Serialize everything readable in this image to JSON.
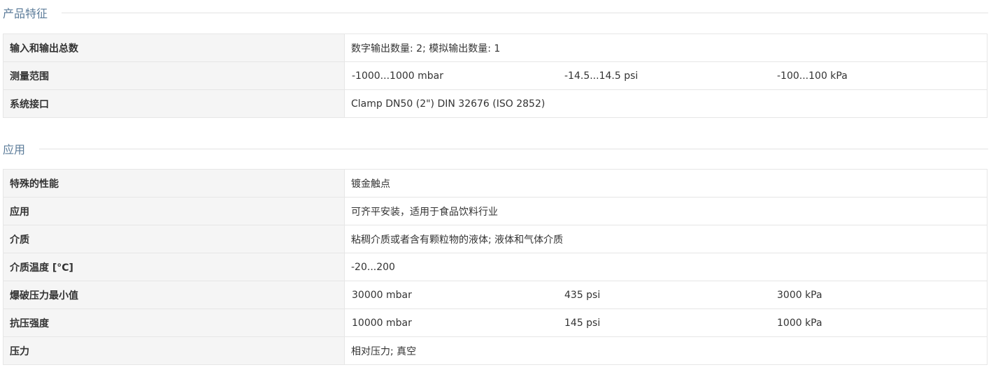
{
  "sections": [
    {
      "title": "产品特征",
      "rows": [
        {
          "label": "输入和输出总数",
          "value": "数字输出数量: 2; 模拟输出数量: 1"
        },
        {
          "label": "测量范围",
          "values": [
            "-1000...1000 mbar",
            "-14.5...14.5 psi",
            "-100...100 kPa"
          ]
        },
        {
          "label": "系统接口",
          "value": "Clamp DN50 (2\") DIN 32676 (ISO 2852)"
        }
      ]
    },
    {
      "title": "应用",
      "rows": [
        {
          "label": "特殊的性能",
          "value": "镀金触点"
        },
        {
          "label": "应用",
          "value": "可齐平安装，适用于食品饮料行业"
        },
        {
          "label": "介质",
          "value": "粘稠介质或者含有颗粒物的液体; 液体和气体介质"
        },
        {
          "label": "介质温度 [°C]",
          "value": "-20...200"
        },
        {
          "label": "爆破压力最小值",
          "values": [
            "30000 mbar",
            "435 psi",
            "3000 kPa"
          ]
        },
        {
          "label": "抗压强度",
          "values": [
            "10000 mbar",
            "145 psi",
            "1000 kPa"
          ]
        },
        {
          "label": "压力",
          "value": "相对压力; 真空"
        }
      ]
    }
  ],
  "colors": {
    "section_title": "#5b7b99",
    "label_bg": "#f5f5f5",
    "border": "#e6e6e6"
  }
}
